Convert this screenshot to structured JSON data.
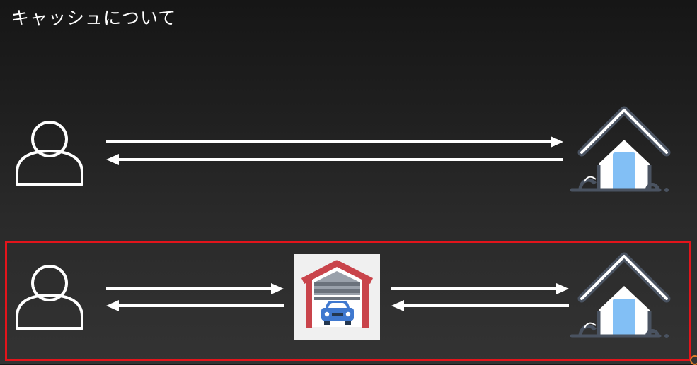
{
  "title": "キャッシュについて",
  "colors": {
    "highlight_border": "#e3141b",
    "arrow": "#ffffff",
    "house_outline": "#4a5361",
    "house_door": "#82bff5",
    "garage_red": "#c9444b",
    "car_blue": "#3f78cf"
  },
  "icons": {
    "user": "user-icon",
    "origin": "house-icon",
    "cache": "garage-icon"
  },
  "flows": {
    "without_cache": [
      "user",
      "origin"
    ],
    "with_cache": [
      "user",
      "cache",
      "origin"
    ]
  }
}
